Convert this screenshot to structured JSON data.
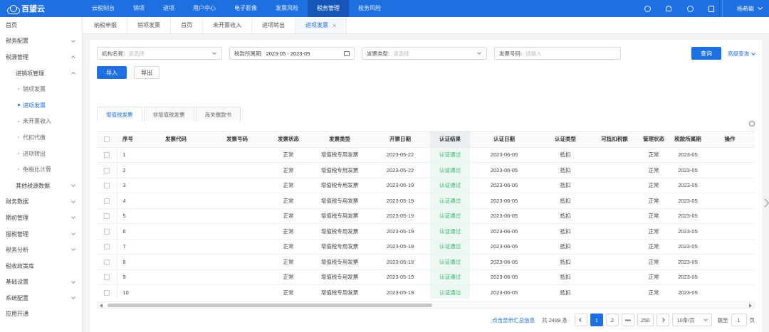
{
  "topbar": {
    "logo": "百望云",
    "nav": [
      "云税制台",
      "销项",
      "进项",
      "用户中心",
      "电子影像",
      "发票风险",
      "税务管理",
      "税务风险"
    ],
    "active_nav": 6,
    "user_name": "杨希聪",
    "icons": [
      "help-icon",
      "bell-icon",
      "clock-icon",
      "doc-icon"
    ]
  },
  "sidebar": {
    "items": [
      {
        "label": "首页",
        "level": 1
      },
      {
        "label": "税务配置",
        "level": 1,
        "chevron": "down"
      },
      {
        "label": "税源管理",
        "level": 1,
        "chevron": "up"
      },
      {
        "label": "进销项管理",
        "level": 2,
        "chevron": "up"
      },
      {
        "label": "销项发票",
        "level": 3
      },
      {
        "label": "进项发票",
        "level": 3,
        "active": true
      },
      {
        "label": "未开票收入",
        "level": 3
      },
      {
        "label": "代扣代缴",
        "level": 3
      },
      {
        "label": "进项转出",
        "level": 3
      },
      {
        "label": "免税比计算",
        "level": 3
      },
      {
        "label": "其他税源数据",
        "level": 2,
        "chevron": "down"
      },
      {
        "label": "财务数据",
        "level": 1,
        "chevron": "down"
      },
      {
        "label": "期初管理",
        "level": 1,
        "chevron": "down"
      },
      {
        "label": "报税管理",
        "level": 1,
        "chevron": "down"
      },
      {
        "label": "税务分析",
        "level": 1,
        "chevron": "down"
      },
      {
        "label": "税收政策库",
        "level": 1
      },
      {
        "label": "基础设置",
        "level": 1,
        "chevron": "down"
      },
      {
        "label": "系统配置",
        "level": 1,
        "chevron": "down"
      },
      {
        "label": "应用开通",
        "level": 1
      }
    ]
  },
  "page_tabs": [
    "纳税申报",
    "销项发票",
    "首页",
    "未开票收入",
    "进项转出",
    "进项发票"
  ],
  "active_page_tab": 5,
  "filters": {
    "org_label": "机构名称:",
    "org_placeholder": "请选择",
    "period_label": "税款所属期:",
    "period_value": "2023-05 - 2023-05",
    "type_label": "发票类型:",
    "type_placeholder": "请选择",
    "number_label": "发票号码:",
    "number_placeholder": "请输入",
    "query_button": "查询",
    "advanced_query": "高级查询"
  },
  "actions": {
    "import_button": "导入",
    "export_button": "导出"
  },
  "sub_tabs": [
    "增值税发票",
    "非增值税发票",
    "海关缴款书"
  ],
  "active_sub_tab": 0,
  "table": {
    "columns": [
      "序号",
      "发票代码",
      "发票号码",
      "发票状态",
      "发票类型",
      "开票日期",
      "认证结果",
      "认证日期",
      "认证类型",
      "可抵扣税额",
      "管理状态",
      "税款所属期",
      "操作"
    ],
    "rows": [
      {
        "seq": "1",
        "status": "正常",
        "type": "增值税专用发票",
        "issue_date": "2023-05-22",
        "auth_result": "认证通过",
        "auth_date": "2023-06-05",
        "auth_type": "抵扣",
        "mgmt": "正常",
        "period": "2023-05"
      },
      {
        "seq": "2",
        "status": "正常",
        "type": "增值税专用发票",
        "issue_date": "2023-05-22",
        "auth_result": "认证通过",
        "auth_date": "2023-06-05",
        "auth_type": "抵扣",
        "mgmt": "正常",
        "period": "2023-05"
      },
      {
        "seq": "3",
        "status": "正常",
        "type": "增值税专用发票",
        "issue_date": "2023-05-19",
        "auth_result": "认证通过",
        "auth_date": "2023-06-05",
        "auth_type": "抵扣",
        "mgmt": "正常",
        "period": "2023-05"
      },
      {
        "seq": "4",
        "status": "正常",
        "type": "增值税专用发票",
        "issue_date": "2023-05-19",
        "auth_result": "认证通过",
        "auth_date": "2023-06-05",
        "auth_type": "抵扣",
        "mgmt": "正常",
        "period": "2023-05"
      },
      {
        "seq": "5",
        "status": "正常",
        "type": "增值税专用发票",
        "issue_date": "2023-05-19",
        "auth_result": "认证通过",
        "auth_date": "2023-06-05",
        "auth_type": "抵扣",
        "mgmt": "正常",
        "period": "2023-05"
      },
      {
        "seq": "6",
        "status": "正常",
        "type": "增值税专用发票",
        "issue_date": "2023-05-19",
        "auth_result": "认证通过",
        "auth_date": "2023-06-05",
        "auth_type": "抵扣",
        "mgmt": "正常",
        "period": "2023-05"
      },
      {
        "seq": "7",
        "status": "正常",
        "type": "增值税专用发票",
        "issue_date": "2023-05-19",
        "auth_result": "认证通过",
        "auth_date": "2023-06-05",
        "auth_type": "抵扣",
        "mgmt": "正常",
        "period": "2023-05"
      },
      {
        "seq": "8",
        "status": "正常",
        "type": "增值税专用发票",
        "issue_date": "2023-05-19",
        "auth_result": "认证通过",
        "auth_date": "2023-06-05",
        "auth_type": "抵扣",
        "mgmt": "正常",
        "period": "2023-05"
      },
      {
        "seq": "9",
        "status": "正常",
        "type": "增值税专用发票",
        "issue_date": "2023-05-19",
        "auth_result": "认证通过",
        "auth_date": "2023-06-05",
        "auth_type": "抵扣",
        "mgmt": "正常",
        "period": "2023-05"
      },
      {
        "seq": "10",
        "status": "正常",
        "type": "增值税专用发票",
        "issue_date": "2023-05-19",
        "auth_result": "认证通过",
        "auth_date": "2023-06-05",
        "auth_type": "抵扣",
        "mgmt": "正常",
        "period": "2023-05"
      }
    ]
  },
  "pagination": {
    "summary_link": "点击显示汇总信息",
    "total": "共 2499 条",
    "pages": [
      "1",
      "2",
      "•••",
      "250"
    ],
    "current_page": "1",
    "page_size": "10条/页",
    "goto_label": "跳至",
    "goto_value": "1",
    "page_unit": "页"
  },
  "colors": {
    "primary": "#1e6fe0",
    "success": "#2fb36a"
  }
}
